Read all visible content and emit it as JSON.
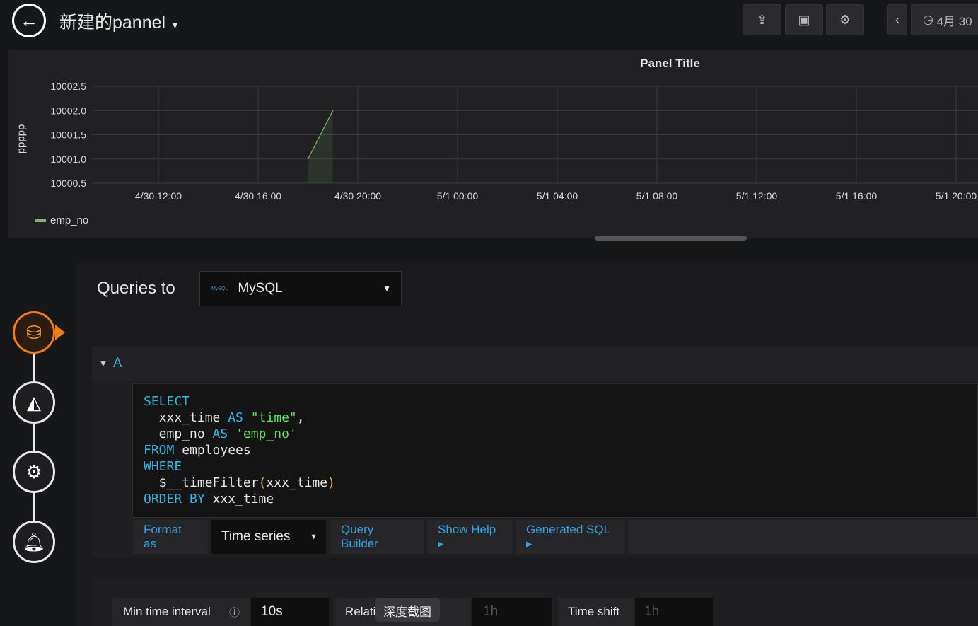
{
  "header": {
    "title": "新建的pannel",
    "time_range": "4月 30"
  },
  "chart_data": {
    "type": "area",
    "title": "Panel Title",
    "ylabel": "ddddd",
    "xlabel": "",
    "y_ticks": [
      "10000.5",
      "10001.0",
      "10001.5",
      "10002.0",
      "10002.5"
    ],
    "ylim": [
      10000.5,
      10002.5
    ],
    "x_ticks": [
      "4/30 12:00",
      "4/30 16:00",
      "4/30 20:00",
      "5/1 00:00",
      "5/1 04:00",
      "5/1 08:00",
      "5/1 12:00",
      "5/1 16:00",
      "5/1 20:00"
    ],
    "series": [
      {
        "name": "emp_no",
        "color": "#7eb26d",
        "points": [
          {
            "x": "4/30 18:00",
            "y": 10001.0
          },
          {
            "x": "4/30 19:00",
            "y": 10002.0
          }
        ]
      }
    ],
    "grid": true,
    "legend": "bottom-left"
  },
  "queries": {
    "label": "Queries to",
    "datasource": "MySQL",
    "query_ref": "A",
    "sql": {
      "l1": "SELECT",
      "l2a": "  xxx_time ",
      "as": "AS",
      "l2s": "\"time\"",
      "comma": ",",
      "l3a": "  emp_no ",
      "l3s": "'emp_no'",
      "from": "FROM",
      "l4": " employees",
      "where": "WHERE",
      "l6a": "  $__timeFilter",
      "lp": "(",
      "l6b": "xxx_time",
      "rp": ")",
      "order": "ORDER BY",
      "l7": " xxx_time"
    },
    "format_as": "Format as",
    "format_value": "Time series",
    "query_builder": "Query Builder",
    "show_help": "Show Help ▸",
    "generated_sql": "Generated SQL ▸"
  },
  "options": {
    "min_interval_label": "Min time interval",
    "min_interval_value": "10s",
    "relative_label": "Relati",
    "relative_placeholder": "1h",
    "time_shift_label": "Time shift",
    "time_shift_placeholder": "1h",
    "tooltip": "深度截图"
  }
}
